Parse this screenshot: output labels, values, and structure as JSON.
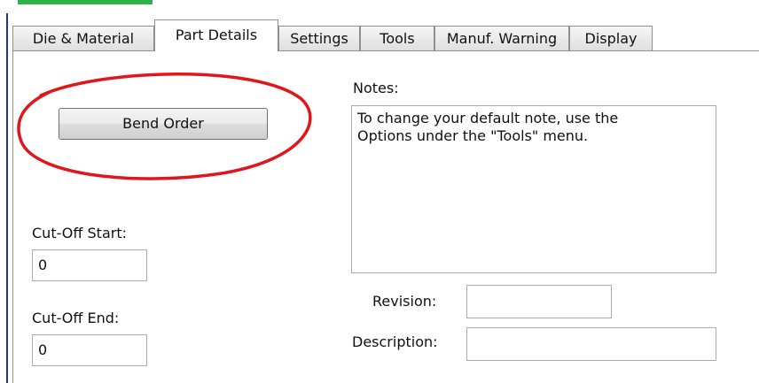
{
  "tabs": [
    {
      "label": "Die & Material",
      "active": false
    },
    {
      "label": "Part Details",
      "active": true
    },
    {
      "label": "Settings",
      "active": false
    },
    {
      "label": "Tools",
      "active": false
    },
    {
      "label": "Manuf. Warning",
      "active": false
    },
    {
      "label": "Display",
      "active": false
    }
  ],
  "buttons": {
    "bend_order": "Bend Order"
  },
  "fields": {
    "cutoff_start": {
      "label": "Cut-Off Start:",
      "value": "0"
    },
    "cutoff_end": {
      "label": "Cut-Off End:",
      "value": "0"
    },
    "revision": {
      "label": "Revision:",
      "value": ""
    },
    "description": {
      "label": "Description:",
      "value": ""
    }
  },
  "notes": {
    "label": "Notes:",
    "text": "To change your default note, use the\nOptions under the \"Tools\" menu."
  },
  "colors": {
    "highlight_ellipse": "#e0161b",
    "accent_bar": "#2fb24a",
    "frame": "#1a3a8f"
  }
}
